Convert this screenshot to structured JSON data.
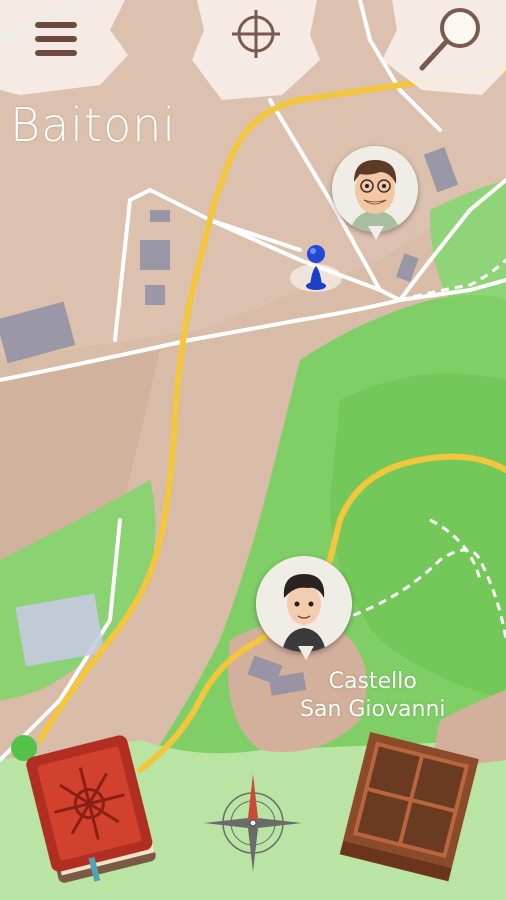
{
  "map": {
    "city_label": "Baitoni",
    "castle_label_line1": "Castello",
    "castle_label_line2": "San Giovanni"
  },
  "toolbar": {
    "menu_icon": "hamburger-menu-icon",
    "locate_icon": "crosshair-icon",
    "search_icon": "magnifier-icon"
  },
  "characters": [
    {
      "name": "man-with-glasses-avatar"
    },
    {
      "name": "boy-avatar"
    }
  ],
  "bottom_bar": {
    "book_icon": "red-book-icon",
    "compass_icon": "compass-rose-icon",
    "inventory_icon": "wooden-box-icon"
  },
  "colors": {
    "road_yellow": "#f3c63b",
    "forest_green": "#7fcf66",
    "terrain": "#d6b39e",
    "pin_blue": "#1d3fc8"
  }
}
